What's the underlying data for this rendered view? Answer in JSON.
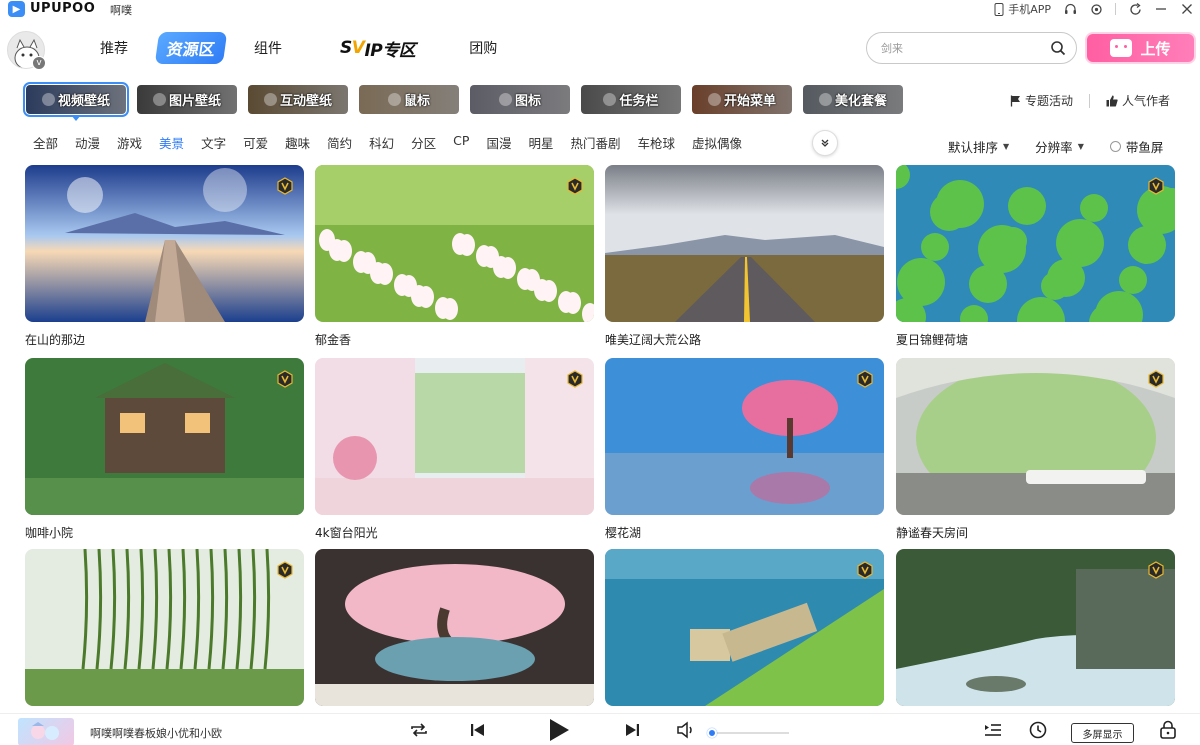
{
  "titlebar": {
    "brand": "UPUPOO",
    "user_name": "啊噗",
    "phone_app": "手机APP"
  },
  "nav": {
    "items": [
      "推荐",
      "资源区",
      "组件",
      "SVIP专区",
      "团购"
    ],
    "active_index": 1
  },
  "search": {
    "placeholder": "剑来"
  },
  "upload_label": "上传",
  "categories": [
    {
      "label": "视频壁纸",
      "active": true,
      "bg": "#2b3b5c"
    },
    {
      "label": "图片壁纸",
      "active": false,
      "bg": "#3a3a3a"
    },
    {
      "label": "互动壁纸",
      "active": false,
      "bg": "#5a4a33"
    },
    {
      "label": "鼠标",
      "active": false,
      "bg": "#7a6a55"
    },
    {
      "label": "图标",
      "active": false,
      "bg": "#5c5c66"
    },
    {
      "label": "任务栏",
      "active": false,
      "bg": "#4a4a4a"
    },
    {
      "label": "开始菜单",
      "active": false,
      "bg": "#6a3f2a"
    },
    {
      "label": "美化套餐",
      "active": false,
      "bg": "#555a60"
    }
  ],
  "right_links": [
    "专题活动",
    "人气作者"
  ],
  "tags": [
    "全部",
    "动漫",
    "游戏",
    "美景",
    "文字",
    "可爱",
    "趣味",
    "简约",
    "科幻",
    "分区",
    "CP",
    "国漫",
    "明星",
    "热门番剧",
    "车枪球",
    "虚拟偶像"
  ],
  "active_tag": 3,
  "sort": {
    "order": "默认排序",
    "resolution": "分辨率",
    "fish_screen": "带鱼屏"
  },
  "wallpapers": [
    {
      "title": "在山的那边",
      "vip": true,
      "scene": "lake-dock"
    },
    {
      "title": "郁金香",
      "vip": true,
      "scene": "tulips"
    },
    {
      "title": "唯美辽阔大荒公路",
      "vip": false,
      "scene": "road"
    },
    {
      "title": "夏日锦鲤荷塘",
      "vip": true,
      "scene": "lotus"
    },
    {
      "title": "咖啡小院",
      "vip": true,
      "scene": "cottage"
    },
    {
      "title": "4k窗台阳光",
      "vip": true,
      "scene": "window"
    },
    {
      "title": "樱花湖",
      "vip": true,
      "scene": "sakura-lake"
    },
    {
      "title": "静谧春天房间",
      "vip": true,
      "scene": "cave-room"
    },
    {
      "title": "",
      "vip": true,
      "scene": "willow"
    },
    {
      "title": "",
      "vip": false,
      "scene": "bonsai"
    },
    {
      "title": "",
      "vip": true,
      "scene": "train"
    },
    {
      "title": "",
      "vip": true,
      "scene": "river"
    }
  ],
  "player": {
    "song": "啊噗啊噗春板娘小优和小欧",
    "multi_screen": "多屏显示",
    "volume": 0.1
  }
}
